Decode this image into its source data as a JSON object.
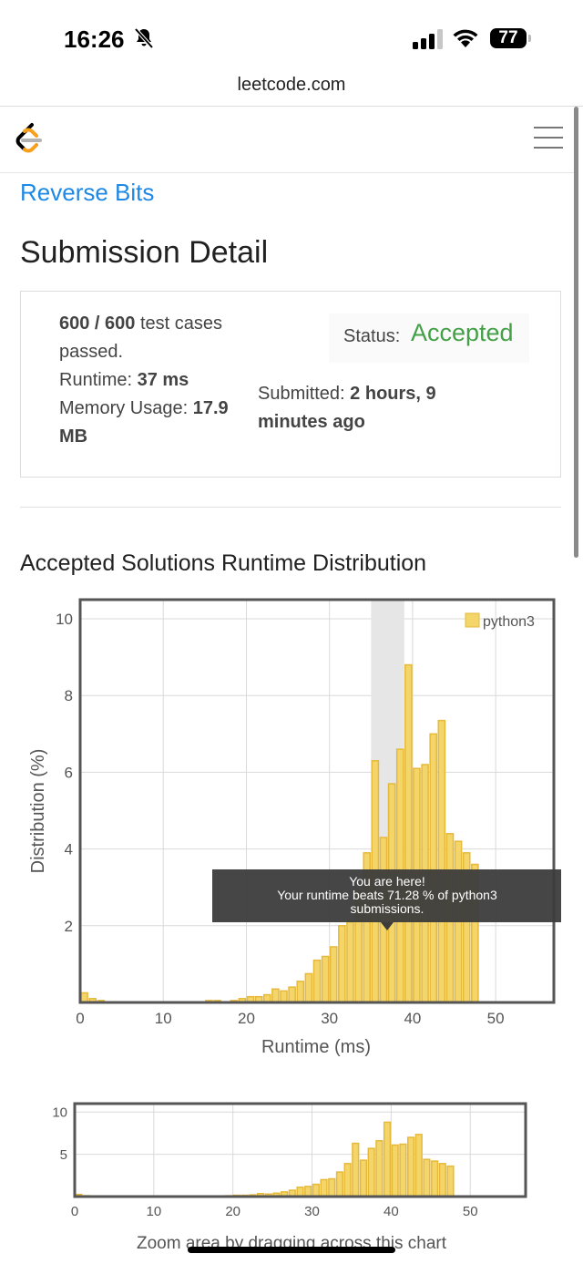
{
  "status_bar": {
    "time": "16:26",
    "battery": "77"
  },
  "browser": {
    "url": "leetcode.com"
  },
  "problem_title": "Reverse Bits",
  "page_title": "Submission Detail",
  "submission": {
    "cases": "600 / 600",
    "cases_suffix": "test cases passed.",
    "runtime_label": "Runtime:",
    "runtime_value": "37 ms",
    "memory_label": "Memory Usage:",
    "memory_value": "17.9 MB",
    "status_label": "Status:",
    "status_value": "Accepted",
    "submitted_label": "Submitted:",
    "submitted_value": "2 hours, 9 minutes ago"
  },
  "chart_heading": "Accepted Solutions Runtime Distribution",
  "tooltip": {
    "line1": "You are here!",
    "line2": "Your runtime beats 71.28 % of python3",
    "line3": "submissions."
  },
  "zoom_hint": "Zoom area by dragging across this chart",
  "colors": {
    "link": "#1e88e5",
    "accepted": "#43a047",
    "bar": "#f4d569",
    "bar_border": "#e6b93a"
  },
  "chart_data": [
    {
      "type": "bar",
      "title": "",
      "xlabel": "Runtime (ms)",
      "ylabel": "Distribution (%)",
      "xlim": [
        0,
        57
      ],
      "ylim": [
        0,
        10.5
      ],
      "xticks": [
        0,
        10,
        20,
        30,
        40,
        50
      ],
      "yticks": [
        2,
        4,
        6,
        8,
        10
      ],
      "legend": "top-right",
      "grid": true,
      "highlight_range": [
        35,
        39
      ],
      "series": [
        {
          "name": "python3",
          "x": [
            0,
            1,
            2,
            15,
            16,
            18,
            19,
            20,
            21,
            22,
            23,
            24,
            25,
            26,
            27,
            28,
            29,
            30,
            31,
            32,
            33,
            34,
            35,
            36,
            37,
            38,
            39,
            40,
            41,
            42,
            43,
            44,
            45,
            46,
            47
          ],
          "values": [
            0.25,
            0.1,
            0.05,
            0.05,
            0.05,
            0.05,
            0.1,
            0.15,
            0.15,
            0.2,
            0.35,
            0.3,
            0.4,
            0.55,
            0.75,
            1.1,
            1.2,
            1.45,
            2.0,
            2.1,
            2.9,
            3.9,
            6.3,
            4.3,
            5.7,
            6.6,
            8.8,
            6.1,
            6.2,
            7.0,
            7.35,
            4.4,
            4.2,
            3.9,
            3.6
          ]
        }
      ]
    },
    {
      "type": "bar",
      "title": "",
      "xlabel": "",
      "ylabel": "",
      "xlim": [
        0,
        57
      ],
      "ylim": [
        0,
        11
      ],
      "xticks": [
        0,
        10,
        20,
        30,
        40,
        50
      ],
      "yticks": [
        5,
        10
      ],
      "grid": true,
      "series": [
        {
          "name": "",
          "x": [
            0,
            1,
            2,
            15,
            16,
            18,
            19,
            20,
            21,
            22,
            23,
            24,
            25,
            26,
            27,
            28,
            29,
            30,
            31,
            32,
            33,
            34,
            35,
            36,
            37,
            38,
            39,
            40,
            41,
            42,
            43,
            44,
            45,
            46,
            47
          ],
          "values": [
            0.25,
            0.1,
            0.05,
            0.05,
            0.05,
            0.05,
            0.1,
            0.15,
            0.15,
            0.2,
            0.35,
            0.3,
            0.4,
            0.55,
            0.75,
            1.1,
            1.2,
            1.45,
            2.0,
            2.1,
            2.9,
            3.9,
            6.3,
            4.3,
            5.7,
            6.6,
            8.8,
            6.1,
            6.2,
            7.0,
            7.35,
            4.4,
            4.2,
            3.9,
            3.6
          ]
        }
      ]
    }
  ]
}
